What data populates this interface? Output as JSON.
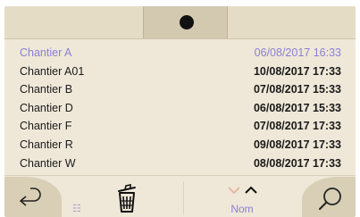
{
  "list": {
    "items": [
      {
        "name": "Chantier A",
        "date": "06/08/2017 16:33",
        "selected": true
      },
      {
        "name": "Chantier A01",
        "date": "10/08/2017 17:33"
      },
      {
        "name": "Chantier B",
        "date": "07/08/2017 15:33"
      },
      {
        "name": "Chantier D",
        "date": "06/08/2017 15:33"
      },
      {
        "name": "Chantier F",
        "date": "07/08/2017 17:33"
      },
      {
        "name": "Chantier R",
        "date": "09/08/2017 17:33"
      },
      {
        "name": "Chantier W",
        "date": "08/08/2017 17:33"
      }
    ]
  },
  "toolbar": {
    "sort_label": "Nom",
    "icons": [
      "back-arrow-icon",
      "list-icon",
      "trash-icon",
      "chevron-down-icon",
      "chevron-up-icon",
      "search-icon"
    ]
  },
  "colors": {
    "background": "#efe8d8",
    "accent": "#8b7fd3",
    "button": "#d8cfb6",
    "text": "#1a1a1a"
  }
}
